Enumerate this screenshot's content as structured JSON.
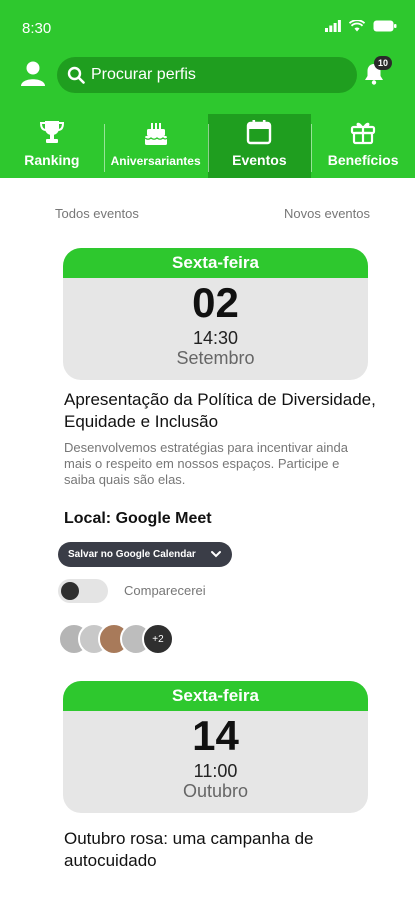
{
  "status_bar": {
    "time": "8:30"
  },
  "search": {
    "placeholder": "Procurar perfis"
  },
  "notifications": {
    "count": "10"
  },
  "tabs": [
    {
      "label": "Ranking",
      "icon": "trophy-icon"
    },
    {
      "label": "Aniversariantes",
      "icon": "cake-icon"
    },
    {
      "label": "Eventos",
      "icon": "calendar-icon",
      "active": true
    },
    {
      "label": "Benefícios",
      "icon": "gift-icon"
    }
  ],
  "filters": {
    "all": "Todos eventos",
    "new": "Novos eventos"
  },
  "events": [
    {
      "weekday": "Sexta-feira",
      "day": "02",
      "time": "14:30",
      "month": "Setembro",
      "title": "Apresentação da Política de Diversidade, Equidade e Inclusão",
      "description": "Desenvolvemos estratégias para incentivar ainda mais o respeito em nossos espaços. Participe e saiba quais são elas.",
      "location": "Local: Google Meet",
      "calendar_button": "Salvar no Google Calendar",
      "attend_label": "Comparecerei",
      "attend_on": false,
      "attendees_more": "+2"
    },
    {
      "weekday": "Sexta-feira",
      "day": "14",
      "time": "11:00",
      "month": "Outubro",
      "title": "Outubro rosa: uma campanha de autocuidado"
    }
  ],
  "colors": {
    "primary": "#2ec82e",
    "primary_dark": "#1f9e1f",
    "card_bg": "#e6e6e6"
  }
}
